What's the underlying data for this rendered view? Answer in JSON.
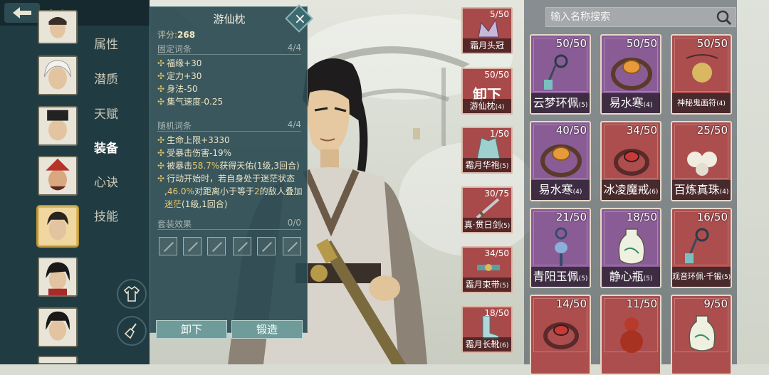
{
  "header": {
    "title": "角色"
  },
  "sidebar": {
    "tabs": [
      {
        "label": "属性",
        "active": false
      },
      {
        "label": "潜质",
        "active": false
      },
      {
        "label": "天赋",
        "active": false
      },
      {
        "label": "装备",
        "active": true
      },
      {
        "label": "心诀",
        "active": false
      },
      {
        "label": "技能",
        "active": false
      }
    ],
    "selected_portrait_index": 4
  },
  "detail": {
    "item_name": "游仙枕",
    "close_icon": "×",
    "score_label": "评分:",
    "score_value": "268",
    "fixed_header": "固定词条",
    "fixed_count": "4/4",
    "fixed_stats": [
      "福缘+30",
      "定力+30",
      "身法-50",
      "集气速度-0.25"
    ],
    "random_header": "随机词条",
    "random_count": "4/4",
    "random_stats": [
      {
        "parts": [
          [
            "生命上限+3330",
            false
          ]
        ]
      },
      {
        "parts": [
          [
            "受暴击伤害-19%",
            false
          ]
        ]
      },
      {
        "parts": [
          [
            "被暴击",
            false
          ],
          [
            "58.7%",
            true
          ],
          [
            "获得天佑(1级,3回合)",
            false
          ]
        ]
      },
      {
        "parts": [
          [
            "行动开始时，若自身处于迷茫状态",
            false
          ]
        ]
      },
      {
        "parts": [
          [
            ",",
            false
          ],
          [
            "46.0%",
            true
          ],
          [
            "对距离小于等于",
            false
          ],
          [
            "2",
            true
          ],
          [
            "的敌人叠加",
            false
          ]
        ]
      },
      {
        "parts": [
          [
            "迷茫",
            true
          ],
          [
            "(1级,1回合)",
            false
          ]
        ]
      }
    ],
    "set_header": "套装效果",
    "set_count": "0/0",
    "unequip_label": "卸下",
    "forge_label": "锻造"
  },
  "equipped": [
    {
      "count": "5/50",
      "name": "霜月头冠",
      "level": "",
      "kind": "crown"
    },
    {
      "count": "50/50",
      "name": "游仙枕",
      "level": "(4)",
      "kind": "unequip",
      "overlay": "卸下"
    },
    {
      "count": "1/50",
      "name": "霜月华袍",
      "level": "(5)",
      "kind": "robe"
    },
    {
      "count": "30/75",
      "name": "真·贯日剑",
      "level": "(5)",
      "kind": "sword"
    },
    {
      "count": "34/50",
      "name": "霜月束带",
      "level": "(5)",
      "kind": "belt"
    },
    {
      "count": "18/50",
      "name": "霜月长靴",
      "level": "(6)",
      "kind": "boots"
    }
  ],
  "search": {
    "placeholder": "输入名称搜索"
  },
  "inventory": [
    {
      "count": "50/50",
      "name": "云梦环佩",
      "level": "(5)",
      "rarity": "purple",
      "kind": "pendant",
      "small": false
    },
    {
      "count": "50/50",
      "name": "易水寒",
      "level": "(4)",
      "rarity": "purple",
      "kind": "bracelet",
      "small": false
    },
    {
      "count": "50/50",
      "name": "神秘鬼画符",
      "level": "(4)",
      "rarity": "red",
      "kind": "charm",
      "small": true
    },
    {
      "count": "40/50",
      "name": "易水寒",
      "level": "(4)",
      "rarity": "purple",
      "kind": "bracelet",
      "small": false
    },
    {
      "count": "34/50",
      "name": "冰凌魔戒",
      "level": "(6)",
      "rarity": "red",
      "kind": "ring",
      "small": false
    },
    {
      "count": "25/50",
      "name": "百炼真珠",
      "level": "(4)",
      "rarity": "red",
      "kind": "pearl",
      "small": false
    },
    {
      "count": "21/50",
      "name": "青阳玉佩",
      "level": "(5)",
      "rarity": "purple",
      "kind": "jade",
      "small": false
    },
    {
      "count": "18/50",
      "name": "静心瓶",
      "level": "(5)",
      "rarity": "purple",
      "kind": "bottle",
      "small": false
    },
    {
      "count": "16/50",
      "name": "观音环佩·千锻",
      "level": "(5)",
      "rarity": "red",
      "kind": "pendant",
      "small": true
    },
    {
      "count": "14/50",
      "name": "",
      "level": "",
      "rarity": "red",
      "kind": "ring",
      "small": false
    },
    {
      "count": "11/50",
      "name": "",
      "level": "",
      "rarity": "red",
      "kind": "gourd",
      "small": false
    },
    {
      "count": "9/50",
      "name": "",
      "level": "",
      "rarity": "red",
      "kind": "bottle",
      "small": false
    }
  ],
  "colors": {
    "rail": "#213b42",
    "panel": "#2b4b52",
    "purple_card": "#8a5c96",
    "red_card": "#ac4e4e",
    "highlight": "#e9c86a"
  }
}
